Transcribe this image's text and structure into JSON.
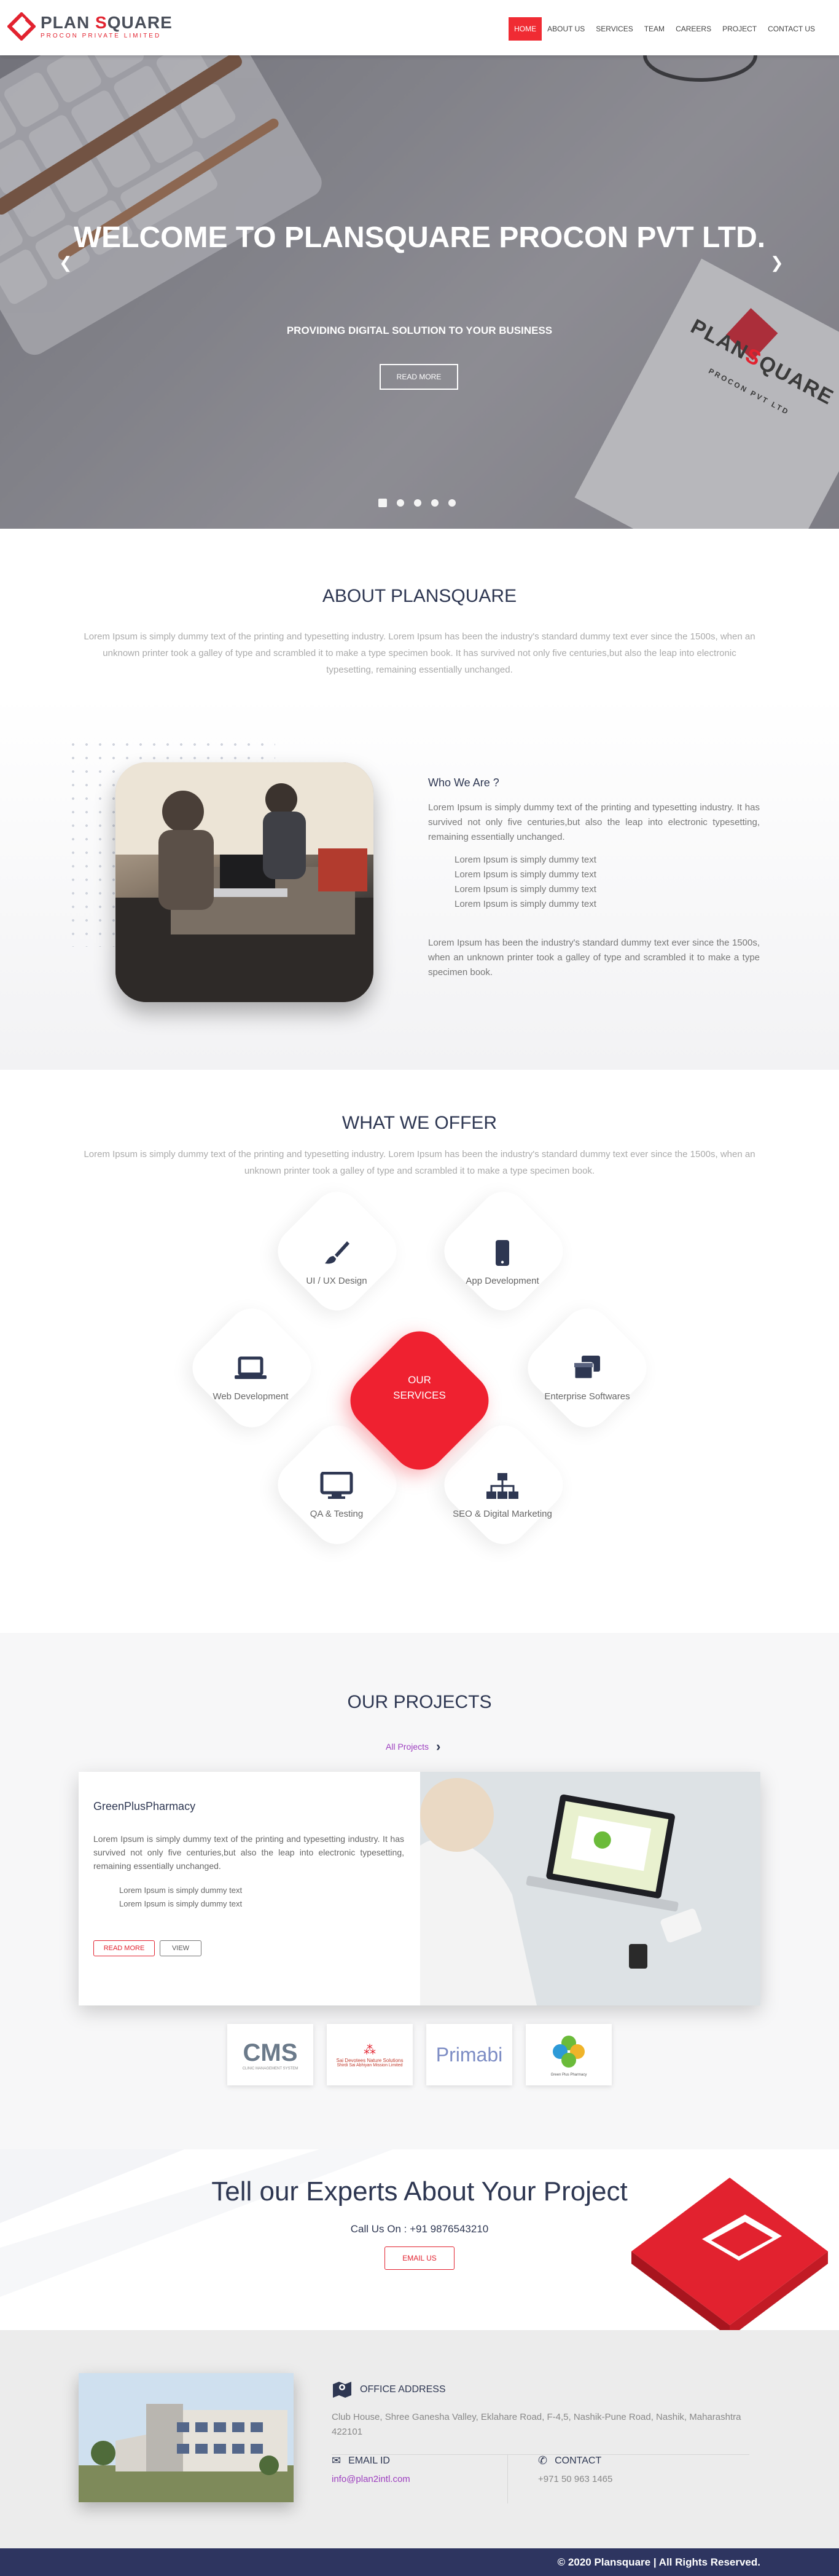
{
  "header": {
    "brand_plan": "PLAN ",
    "brand_s": "S",
    "brand_quare": "QUARE",
    "brand_sub": "PROCON PRIVATE LIMITED",
    "nav": [
      "HOME",
      "ABOUT US",
      "SERVICES",
      "TEAM",
      "CAREERS",
      "PROJECT",
      "CONTACT US"
    ]
  },
  "hero": {
    "title": "WELCOME TO PLANSQUARE PROCON PVT LTD.",
    "subtitle": "PROVIDING DIGITAL SOLUTION TO YOUR BUSINESS",
    "button": "READ MORE",
    "card_brand_1": "PLAN",
    "card_brand_s": "S",
    "card_brand_2": "QUARE",
    "card_sub": "PROCON PVT LTD",
    "slide_count": 5,
    "active_slide": 1
  },
  "about": {
    "title": "ABOUT PLANSQUARE",
    "text": "Lorem Ipsum is simply dummy text of the printing and typesetting industry. Lorem Ipsum has been the industry's standard dummy text ever since the 1500s, when an unknown printer took a galley of type and scrambled it to make a type specimen book. It has survived not only five centuries,but also the leap into electronic typesetting, remaining essentially unchanged.",
    "who_title": "Who We Are ?",
    "who_p1": "Lorem Ipsum is simply dummy text of the printing and typesetting industry. It has survived not only five centuries,but also the leap into electronic typesetting, remaining essentially unchanged.",
    "who_list": [
      "Lorem Ipsum is simply dummy text",
      "Lorem Ipsum is simply dummy text",
      "Lorem Ipsum is simply dummy text",
      "Lorem Ipsum is simply dummy text"
    ],
    "who_p2": "Lorem Ipsum has been the industry's standard dummy text ever since the 1500s, when an unknown printer took a galley of type and scrambled it to make a type specimen book."
  },
  "offer": {
    "title": "WHAT WE OFFER",
    "text": "Lorem Ipsum is simply dummy text of the printing and typesetting industry. Lorem Ipsum has been the industry's standard dummy text ever since the 1500s, when an unknown printer took a galley of type and scrambled it to make a type specimen book.",
    "center_line1": "OUR",
    "center_line2": "SERVICES",
    "services": [
      {
        "label": "UI / UX Design",
        "icon": "paintbrush-icon"
      },
      {
        "label": "App Development",
        "icon": "mobile-icon"
      },
      {
        "label": "Web Development",
        "icon": "laptop-icon"
      },
      {
        "label": "Enterprise Softwares",
        "icon": "windows-icon"
      },
      {
        "label": "QA & Testing",
        "icon": "desktop-icon"
      },
      {
        "label": "SEO & Digital Marketing",
        "icon": "sitemap-icon"
      }
    ]
  },
  "projects": {
    "title": "OUR PROJECTS",
    "all_link": "All Projects",
    "card_title": "GreenPlusPharmacy",
    "card_text": "Lorem Ipsum is simply dummy text of the printing and typesetting industry. It has survived not only five centuries,but also the leap into electronic typesetting, remaining essentially unchanged.",
    "card_list": [
      "Lorem Ipsum is simply dummy text",
      "Lorem Ipsum is simply dummy text"
    ],
    "read_more": "READ MORE",
    "view": "VIEW",
    "clients": [
      {
        "name": "CMS",
        "sub": "CLINIC MANAGEMENT SYSTEM"
      },
      {
        "name": "Sai Devotees Nature Solutions",
        "sub": "Shirdi Sai Abhiyan Mission Limited"
      },
      {
        "name": "Primabi",
        "sub": ""
      },
      {
        "name": "GreenPlusPharmacy",
        "sub": "Green Plus Pharmacy"
      }
    ]
  },
  "experts": {
    "title": "Tell our Experts About Your Project",
    "call": "Call Us On : +91 9876543210",
    "button": "EMAIL US"
  },
  "contact": {
    "office_title": "OFFICE ADDRESS",
    "office_text": "Club House, Shree Ganesha Valley, Eklahare Road, F-4,5, Nashik-Pune Road, Nashik, Maharashtra 422101",
    "email_title": "EMAIL ID",
    "email": "info@plan2intl.com",
    "contact_title": "CONTACT",
    "phone": "+971 50 963 1465"
  },
  "footer": {
    "copyright": "© 2020 Plansquare | All Rights Reserved."
  },
  "colors": {
    "accent": "#e2222f",
    "navy": "#2e3752",
    "footer": "#2e3560"
  }
}
